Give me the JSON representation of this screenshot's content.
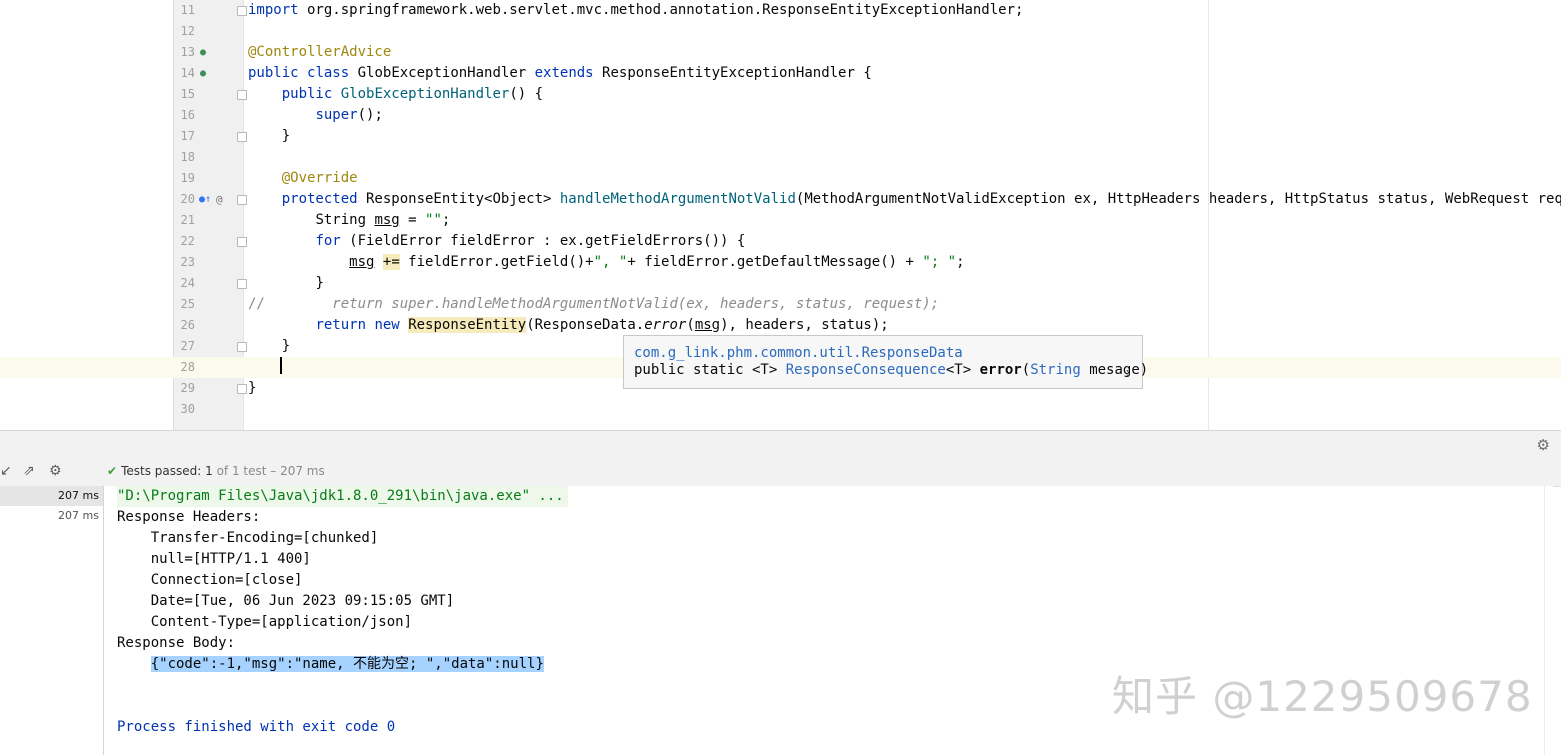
{
  "editor": {
    "lines": [
      {
        "n": "11"
      },
      {
        "n": "12"
      },
      {
        "n": "13"
      },
      {
        "n": "14"
      },
      {
        "n": "15"
      },
      {
        "n": "16"
      },
      {
        "n": "17"
      },
      {
        "n": "18"
      },
      {
        "n": "19"
      },
      {
        "n": "20"
      },
      {
        "n": "21"
      },
      {
        "n": "22"
      },
      {
        "n": "23"
      },
      {
        "n": "24"
      },
      {
        "n": "25"
      },
      {
        "n": "26"
      },
      {
        "n": "27"
      },
      {
        "n": "28"
      },
      {
        "n": "29"
      },
      {
        "n": "30"
      }
    ],
    "code": {
      "l11_kw": "import",
      "l11_rest": " org.springframework.web.servlet.mvc.method.annotation.ResponseEntityExceptionHandler;",
      "l13_ann": "@ControllerAdvice",
      "l14_kw1": "public",
      "l14_kw2": "class",
      "l14_name": " GlobExceptionHandler ",
      "l14_kw3": "extends",
      "l14_rest": " ResponseEntityExceptionHandler {",
      "l15_kw": "public",
      "l15_fn": "GlobExceptionHandler",
      "l15_rest": "() {",
      "l16_kw": "super",
      "l16_rest": "();",
      "l17": "}",
      "l19_ann": "@Override",
      "l20_kw": "protected",
      "l20_type": " ResponseEntity<Object> ",
      "l20_fn": "handleMethodArgumentNotValid",
      "l20_rest": "(MethodArgumentNotValidException ex, HttpHeaders headers, HttpStatus status, WebRequest request) {",
      "l21_a": "String ",
      "l21_var": "msg",
      "l21_b": " = ",
      "l21_str": "\"\"",
      "l21_c": ";",
      "l22_kw": "for",
      "l22_rest": " (FieldError fieldError : ex.getFieldErrors()) {",
      "l23_var": "msg",
      "l23_op": "+=",
      "l23_a": " fieldError.getField()+",
      "l23_str1": "\", \"",
      "l23_b": "+ fieldError.getDefaultMessage() + ",
      "l23_str2": "\"; \"",
      "l23_c": ";",
      "l24": "}",
      "l25_slash": "//",
      "l25_comment": "        return super.handleMethodArgumentNotValid(ex, headers, status, request);",
      "l26_kw1": "return",
      "l26_kw2": "new",
      "l26_cls": "ResponseEntity",
      "l26_a": "(ResponseData.",
      "l26_it": "error",
      "l26_b": "(",
      "l26_var": "msg",
      "l26_c": "), headers, status);",
      "l27": "}",
      "l29": "}"
    }
  },
  "tooltip": {
    "package": "com.g_link.phm.common.util.ResponseData",
    "sig_a": "public static <T> ",
    "sig_type": "ResponseConsequence",
    "sig_b": "<T> ",
    "sig_method": "error",
    "sig_c": "(",
    "sig_param_type": "String",
    "sig_d": " mesage)",
    "more": "⋮"
  },
  "run_panel": {
    "status_label": "Tests passed:",
    "passed": "1",
    "of_text": "of 1 test – 207 ms",
    "tree": [
      {
        "time": "207 ms",
        "selected": true
      },
      {
        "time": "207 ms",
        "selected": false
      }
    ],
    "console": {
      "command": "\"D:\\Program Files\\Java\\jdk1.8.0_291\\bin\\java.exe\" ...",
      "lines": [
        "Response Headers:",
        "    Transfer-Encoding=[chunked]",
        "    null=[HTTP/1.1 400]",
        "    Connection=[close]",
        "    Date=[Tue, 06 Jun 2023 09:15:05 GMT]",
        "    Content-Type=[application/json]",
        "Response Body:"
      ],
      "body": "{\"code\":-1,\"msg\":\"name, 不能为空; \",\"data\":null}",
      "finished": "Process finished with exit code 0"
    }
  },
  "watermark": "知乎 @1229509678"
}
